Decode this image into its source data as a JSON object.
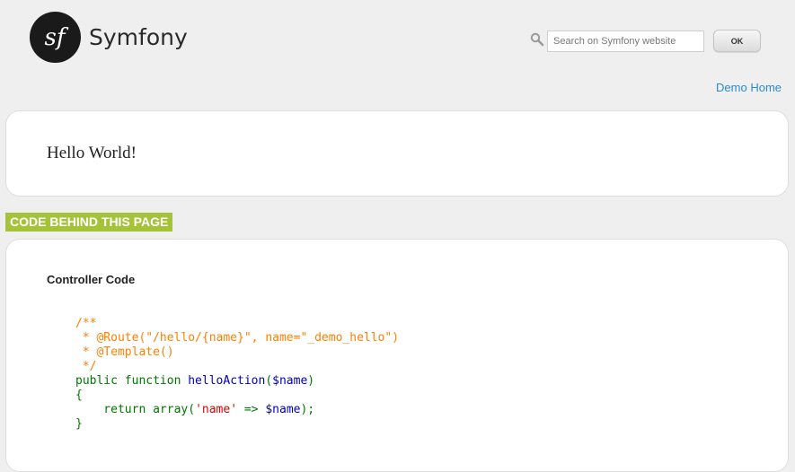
{
  "header": {
    "brand": "Symfony",
    "logo_glyph": "sf",
    "search_placeholder": "Search on Symfony website",
    "search_value": "",
    "ok_label": "OK"
  },
  "nav": {
    "demo_home": "Demo Home"
  },
  "main": {
    "greeting": "Hello World!"
  },
  "code_section": {
    "label": "CODE BEHIND THIS PAGE",
    "controller_title": "Controller Code",
    "lines": {
      "l1": "/**",
      "l2": " * @Route(\"/hello/{name}\", name=\"_demo_hello\")",
      "l3": " * @Template()",
      "l4": " */",
      "l5_kw": "public function ",
      "l5_fn": "helloAction",
      "l5_open": "(",
      "l5_var": "$name",
      "l5_close": ")",
      "l6": "{",
      "l7_kw": "    return array(",
      "l7_str": "'name'",
      "l7_arrow": " => ",
      "l7_var": "$name",
      "l7_end": ");",
      "l8": "}"
    }
  },
  "colors": {
    "background": "#efefef",
    "link": "#2a8ad0",
    "label_green": "#a5c23b",
    "comment_orange": "#ff8000",
    "keyword_green": "#007700",
    "function_blue": "#0000bb",
    "string_red": "#dd0000"
  }
}
